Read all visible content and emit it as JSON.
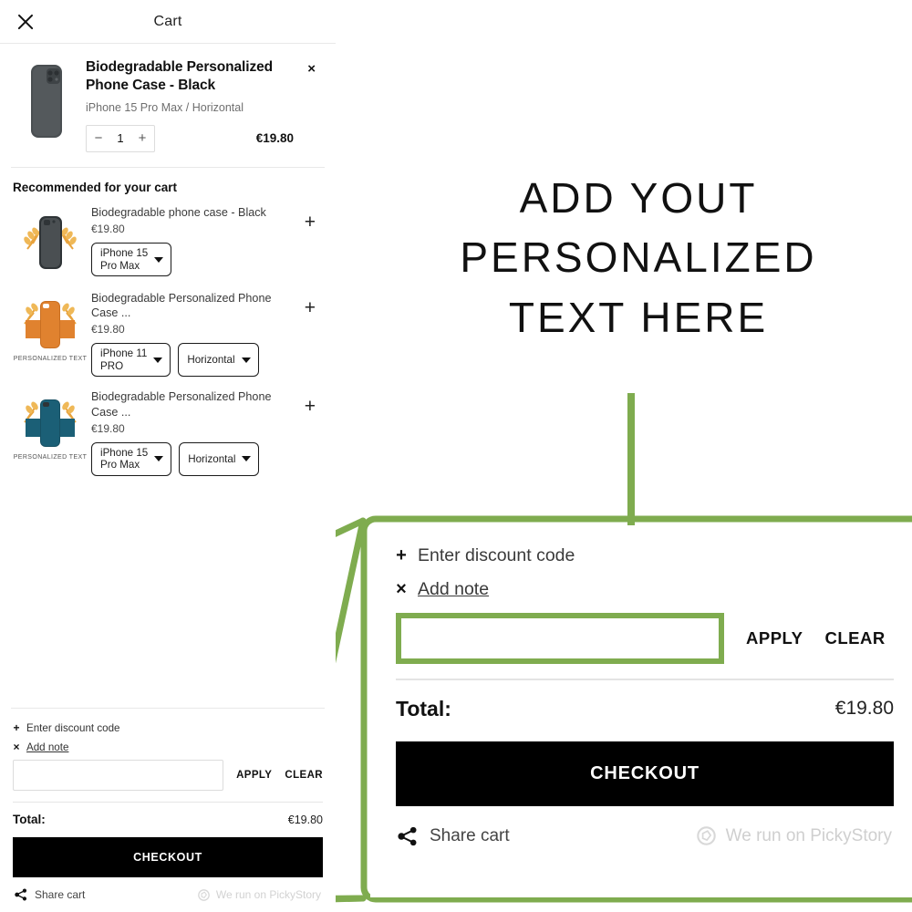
{
  "header": {
    "title": "Cart",
    "close_icon": "close-icon"
  },
  "line_item": {
    "title": "Biodegradable Personalized Phone Case - Black",
    "variant": "iPhone 15 Pro Max / Horizontal",
    "quantity": "1",
    "minus": "−",
    "plus": "+",
    "price": "€19.80",
    "remove_icon": "×"
  },
  "recommendations": {
    "title": "Recommended for your cart",
    "items": [
      {
        "name": "Biodegradable phone case - Black",
        "price": "€19.80",
        "add_label": "+",
        "case_color": "#4a4f52",
        "selects": [
          {
            "value": "iPhone 15\nPro Max"
          }
        ],
        "thumb_label": ""
      },
      {
        "name": "Biodegradable Personalized Phone Case ...",
        "price": "€19.80",
        "add_label": "+",
        "case_color": "#e0822f",
        "selects": [
          {
            "value": "iPhone 11\nPRO"
          },
          {
            "value": "Horizontal"
          }
        ],
        "thumb_label": "PERSONALIZED TEXT"
      },
      {
        "name": "Biodegradable Personalized Phone Case ...",
        "price": "€19.80",
        "add_label": "+",
        "case_color": "#1b5f76",
        "selects": [
          {
            "value": "iPhone 15\nPro Max"
          },
          {
            "value": "Horizontal"
          }
        ],
        "thumb_label": "PERSONALIZED TEXT"
      }
    ]
  },
  "summary": {
    "discount_label": "Enter discount code",
    "discount_sym": "+",
    "note_label": "Add note",
    "note_sym": "×",
    "note_value": "",
    "note_placeholder": "",
    "apply_label": "APPLY",
    "clear_label": "CLEAR",
    "total_label": "Total:",
    "total_value": "€19.80",
    "checkout_label": "CHECKOUT",
    "share_label": "Share cart",
    "powered_label": "We run on PickyStory"
  },
  "headline": {
    "line1": "ADD YOUT",
    "line2": "PERSONALIZED",
    "line3": "TEXT HERE"
  },
  "colors": {
    "accent_green": "#7fac4f",
    "checkout_bg": "#000000",
    "text": "#1a1a1a",
    "muted": "#6f6f6f"
  }
}
